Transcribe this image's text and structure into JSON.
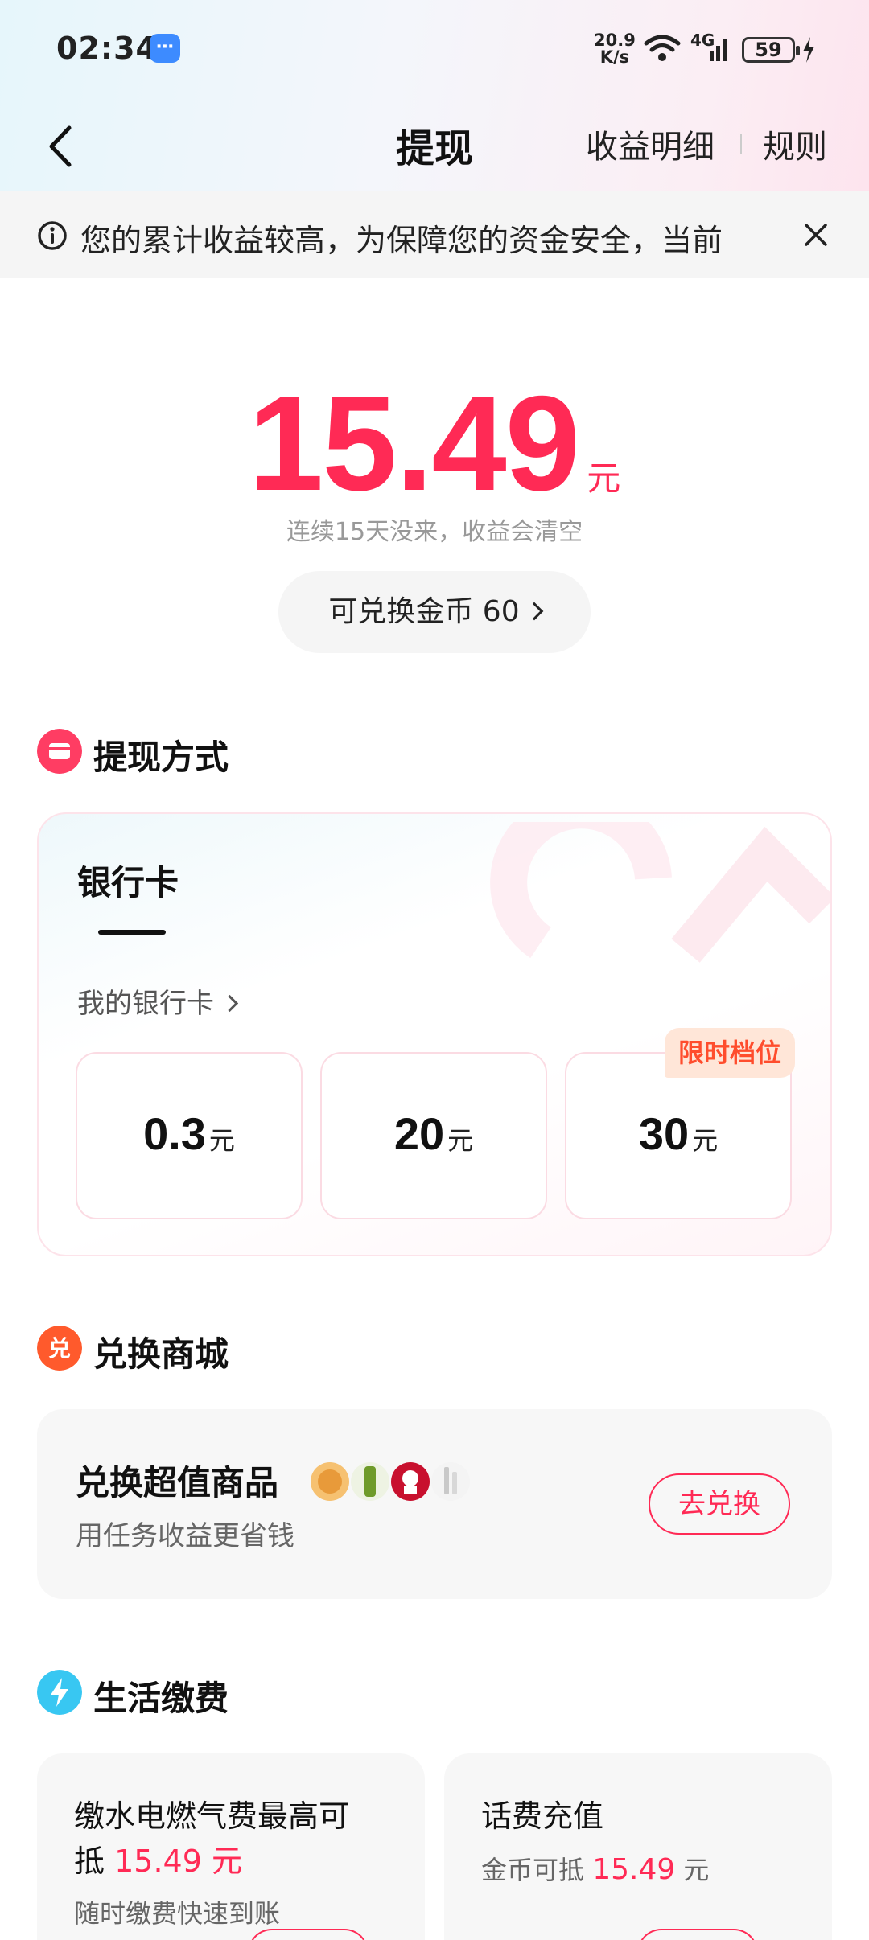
{
  "status_bar": {
    "time": "02:34",
    "speed_value": "20.9",
    "speed_unit": "K/s",
    "network": "4G",
    "battery": "59",
    "icons": [
      "message-icon",
      "wifi-icon",
      "signal-icon",
      "battery-icon",
      "charging-icon"
    ]
  },
  "header": {
    "title": "提现",
    "detail_link": "收益明细",
    "rules_link": "规则"
  },
  "notice": {
    "text": "您的累计收益较高，为保障您的资金安全，当前"
  },
  "balance": {
    "amount": "15.49",
    "unit": "元",
    "tip": "连续15天没来，收益会清空",
    "coin_exchange_label": "可兑换金币 60"
  },
  "withdraw_section": {
    "title": "提现方式",
    "tab": "银行卡",
    "my_card_label": "我的银行卡",
    "options": [
      {
        "value": "0.3",
        "unit": "元"
      },
      {
        "value": "20",
        "unit": "元"
      },
      {
        "value": "30",
        "unit": "元"
      }
    ],
    "limited_badge": "限时档位"
  },
  "mall_section": {
    "title": "兑换商城",
    "card_title": "兑换超值商品",
    "card_subtitle": "用任务收益更省钱",
    "button": "去兑换"
  },
  "life_section": {
    "title": "生活缴费",
    "utility": {
      "title_a": "缴水电燃气费最高可",
      "title_b": "抵",
      "amount": "15.49 元",
      "subtitle": "随时缴费快速到账"
    },
    "phone": {
      "title": "话费充值",
      "sub_prefix": "金币可抵",
      "amount": "15.49",
      "unit": "元"
    }
  },
  "colors": {
    "accent": "#ff2a55",
    "badge_text": "#ff4d2d",
    "badge_bg": "#ffe6d8",
    "card_bg": "#f7f7f7"
  }
}
